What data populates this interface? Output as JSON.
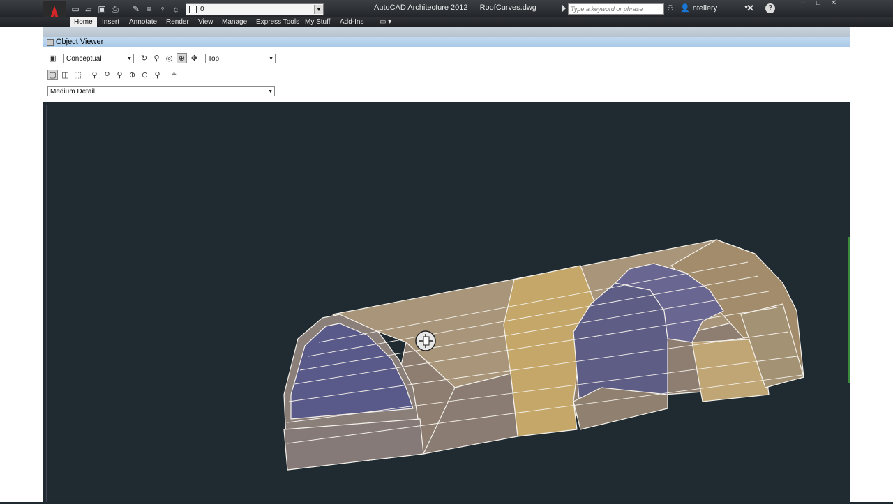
{
  "window": {
    "app_name": "AutoCAD Architecture 2012",
    "file_name": "RoofCurves.dwg",
    "layer_value": "0"
  },
  "search": {
    "placeholder": "Type a keyword or phrase"
  },
  "user": {
    "name": "ntellery"
  },
  "menu_tabs": [
    {
      "label": "Home",
      "active": true
    },
    {
      "label": "Insert"
    },
    {
      "label": "Annotate"
    },
    {
      "label": "Render"
    },
    {
      "label": "View"
    },
    {
      "label": "Manage"
    },
    {
      "label": "Express Tools"
    },
    {
      "label": "My Stuff"
    },
    {
      "label": "Add-Ins"
    }
  ],
  "object_viewer": {
    "title": "Object Viewer",
    "visual_style": "Conceptual",
    "view_direction": "Top",
    "detail_level": "Medium Detail"
  },
  "colors": {
    "viewport_bg": "#1f2a31",
    "vault_tan": "#a89270",
    "vault_highlight": "#c6a96a",
    "vault_shadow": "#5a5a86",
    "title_blue": "#b4d1ec"
  }
}
